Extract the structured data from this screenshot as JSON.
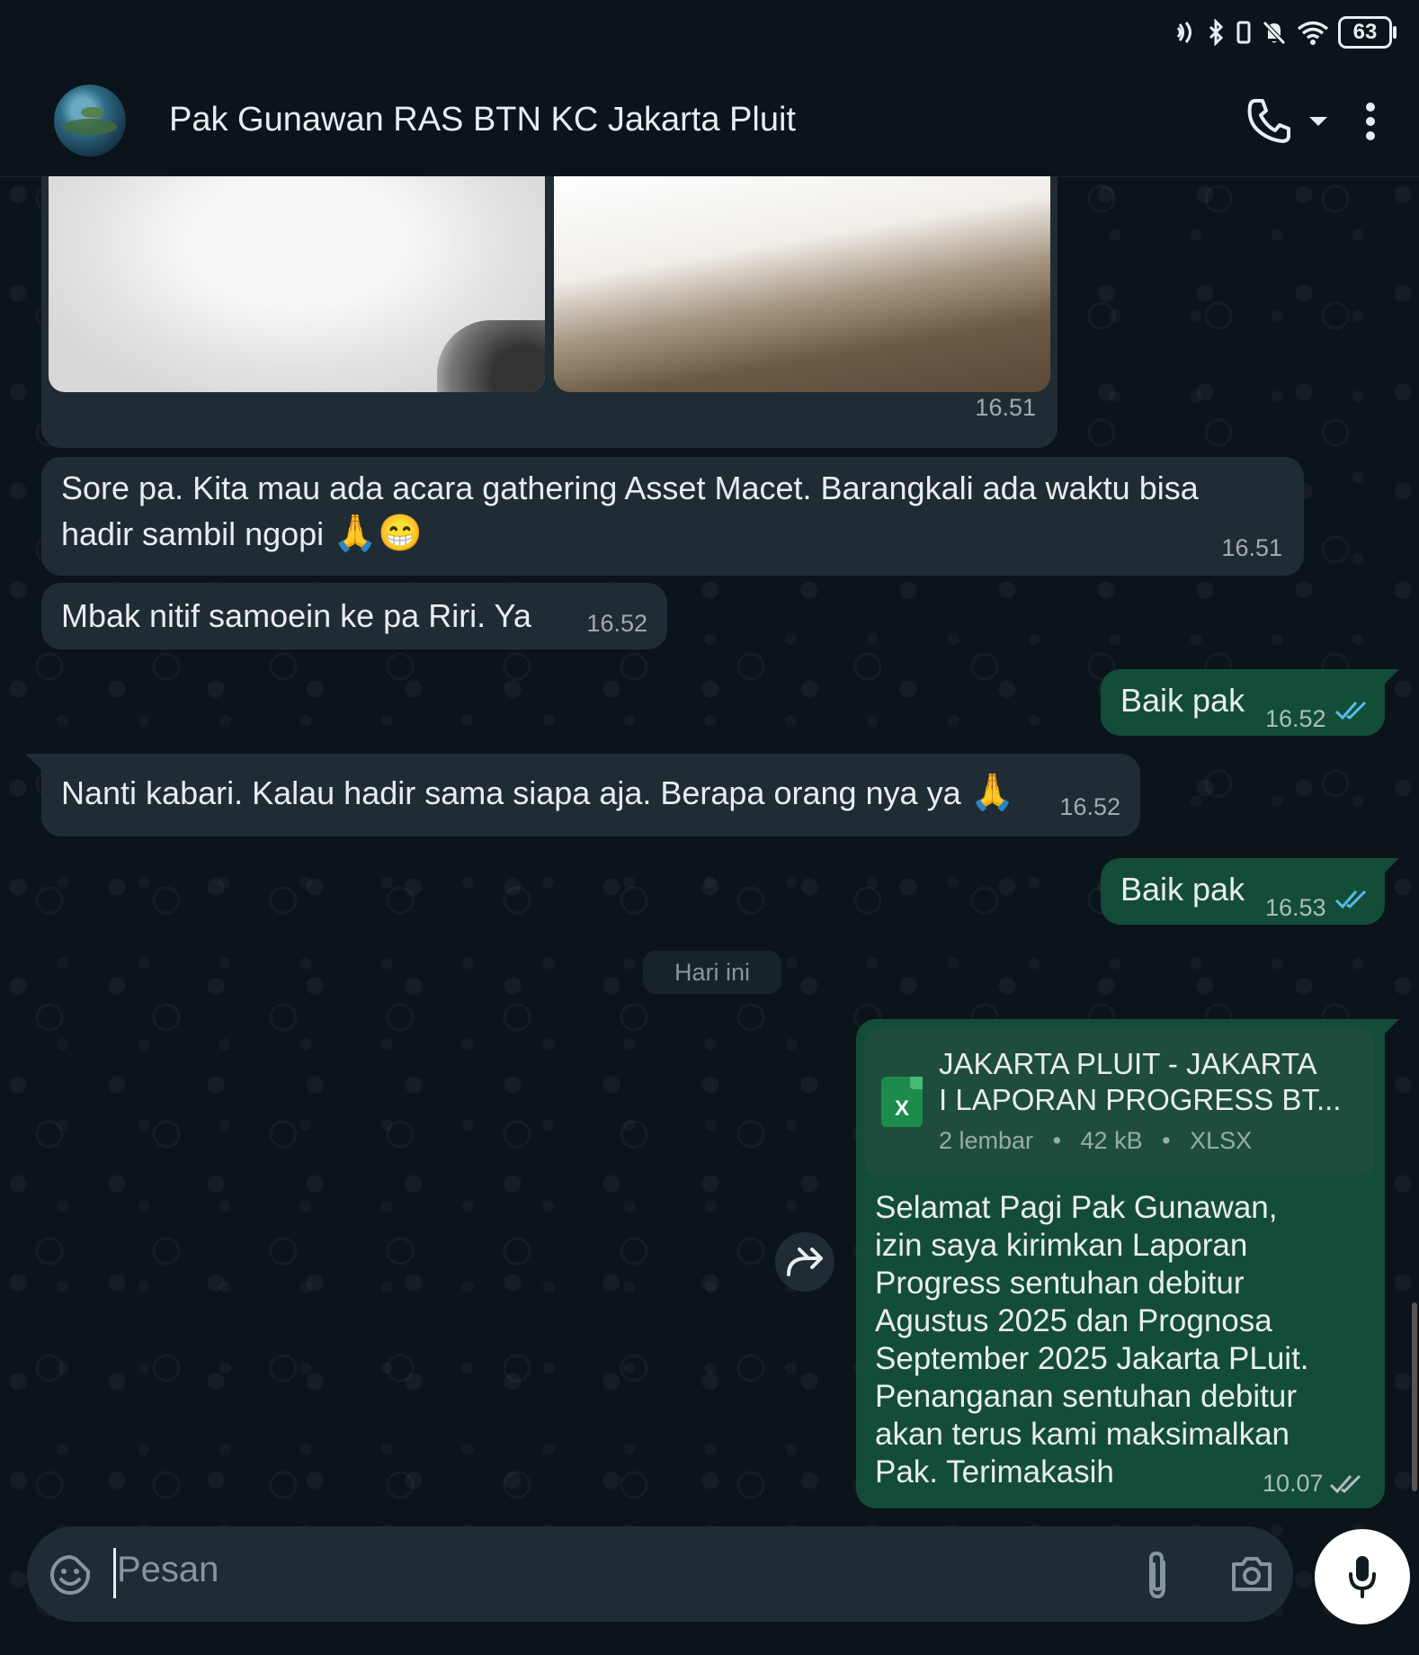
{
  "status": {
    "battery": "63"
  },
  "header": {
    "contact_name": "Pak Gunawan RAS BTN KC Jakarta Pluit"
  },
  "messages": [
    {
      "type": "photos",
      "direction": "in",
      "time": "16.51"
    },
    {
      "type": "text",
      "direction": "in",
      "line1": "Sore pa.  Kita mau ada acara gathering Asset Macet. Barangkali ada waktu bisa",
      "line2": "hadir sambil ngopi",
      "emoji": "🙏😁",
      "time": "16.51"
    },
    {
      "type": "text",
      "direction": "in",
      "text": "Mbak nitif samoein ke pa  Riri.  Ya",
      "time": "16.52"
    },
    {
      "type": "text",
      "direction": "out",
      "text": "Baik pak",
      "time": "16.52",
      "status": "read"
    },
    {
      "type": "text",
      "direction": "in",
      "text": "Nanti kabari. Kalau hadir sama siapa aja. Berapa orang nya ya",
      "emoji": "🙏",
      "time": "16.52"
    },
    {
      "type": "text",
      "direction": "out",
      "text": "Baik pak",
      "time": "16.53",
      "status": "read"
    },
    {
      "type": "document",
      "direction": "out",
      "file_name_line1": "JAKARTA PLUIT - JAKARTA",
      "file_name_line2": "I LAPORAN PROGRESS BT...",
      "pages": "2 lembar",
      "size": "42 kB",
      "ext": "XLSX",
      "icon_letter": "X",
      "caption": [
        "Selamat Pagi Pak Gunawan,",
        "izin saya kirimkan Laporan",
        "Progress sentuhan debitur",
        "Agustus 2025 dan Prognosa",
        "September 2025 Jakarta PLuit.",
        "Penanganan sentuhan debitur",
        "akan terus kami maksimalkan",
        "Pak. Terimakasih"
      ],
      "time": "10.07",
      "status": "delivered"
    }
  ],
  "day_divider": "Hari ini",
  "composer": {
    "placeholder": "Pesan"
  },
  "icons": [
    "phone-icon",
    "dropdown-icon",
    "more-vert-icon",
    "forward-icon",
    "emoji-icon",
    "attach-icon",
    "camera-icon",
    "mic-icon"
  ],
  "colors": {
    "background": "#0b141a",
    "incoming": "#202c33",
    "outgoing": "#005c4b",
    "read_ticks": "#53bdeb"
  }
}
